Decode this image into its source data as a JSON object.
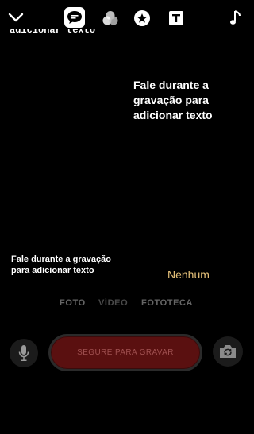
{
  "top_bar": {
    "icons": [
      "chevron-down-icon",
      "captions-icon",
      "filters-icon",
      "stickers-icon",
      "text-icon",
      "music-icon"
    ]
  },
  "captions": {
    "partial_top": "adicionar texto",
    "large": "Fale durante a\ngravação para\nadicionar texto",
    "small": "Fale durante a gravação\npara adicionar texto"
  },
  "style_option": "Nenhum",
  "modes": [
    "FOTO",
    "VÍDEO",
    "FOTOTECA"
  ],
  "selected_mode": "VÍDEO",
  "record_button": "SEGURE PARA GRAVAR",
  "colors": {
    "background": "#000000",
    "accent": "#e7c27a",
    "record": "#5a1010"
  }
}
